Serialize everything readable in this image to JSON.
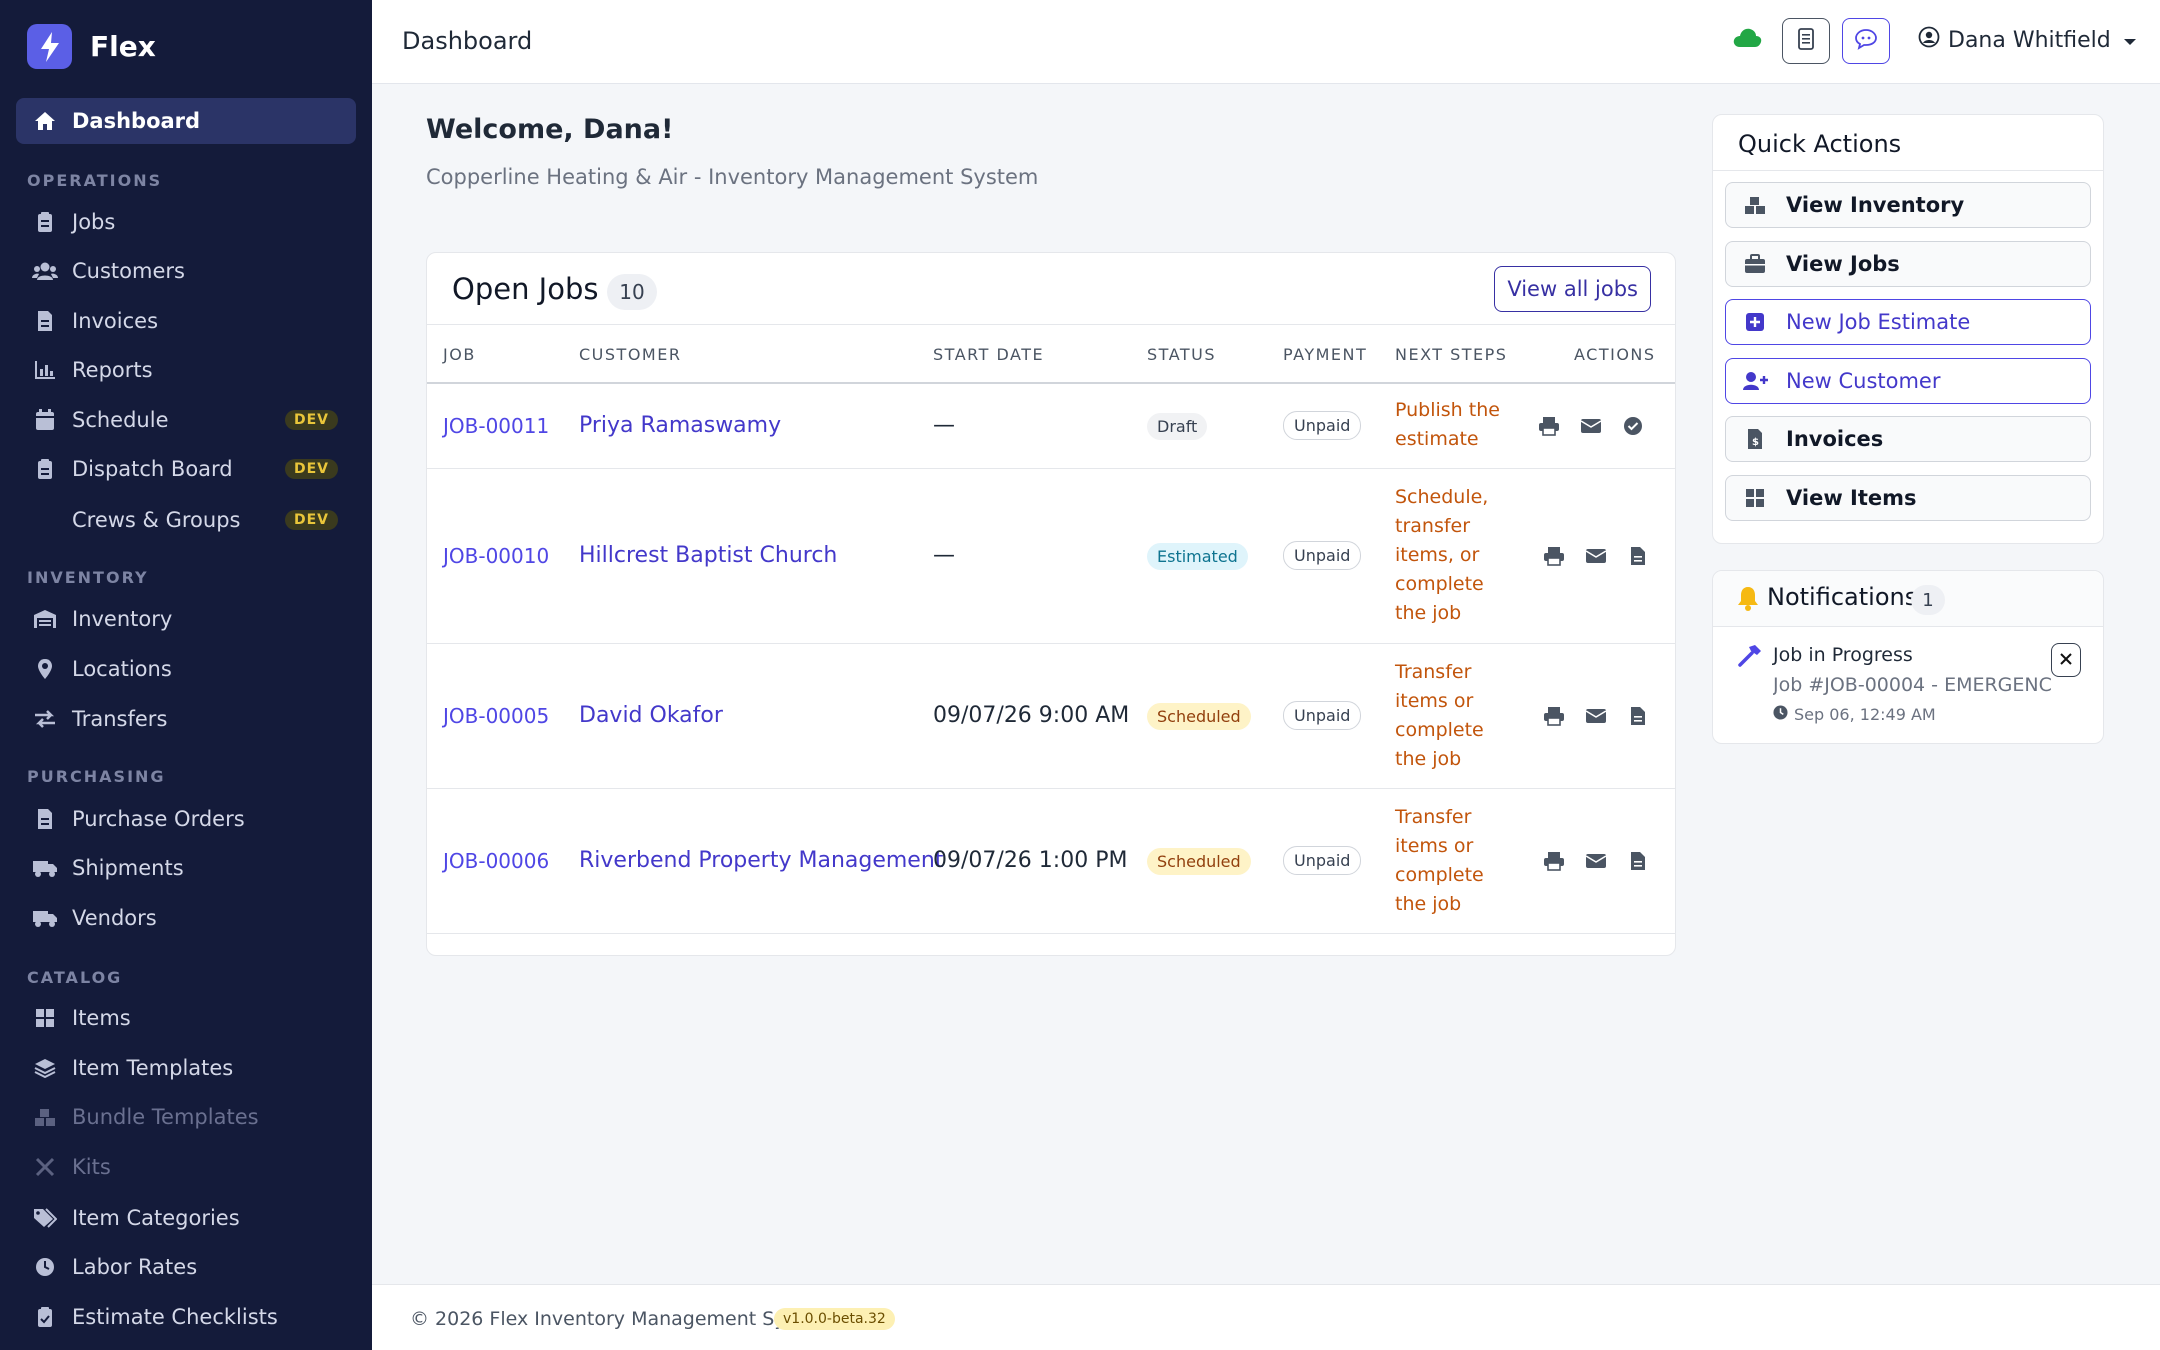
{
  "brand": {
    "name": "Flex"
  },
  "sidebar": {
    "dashboard": "Dashboard",
    "sections": {
      "operations": "OPERATIONS",
      "inventory": "INVENTORY",
      "purchasing": "PURCHASING",
      "catalog": "CATALOG"
    },
    "items": {
      "jobs": "Jobs",
      "customers": "Customers",
      "invoices": "Invoices",
      "reports": "Reports",
      "schedule": "Schedule",
      "dispatch": "Dispatch Board",
      "crews": "Crews & Groups",
      "inventory": "Inventory",
      "locations": "Locations",
      "transfers": "Transfers",
      "purchase_orders": "Purchase Orders",
      "shipments": "Shipments",
      "vendors": "Vendors",
      "items": "Items",
      "item_templates": "Item Templates",
      "bundle_templates": "Bundle Templates",
      "kits": "Kits",
      "item_categories": "Item Categories",
      "labor_rates": "Labor Rates",
      "estimate_checklists": "Estimate Checklists"
    },
    "dev_badge": "DEV"
  },
  "topbar": {
    "title": "Dashboard",
    "user": "Dana Whitfield"
  },
  "main": {
    "welcome": "Welcome, Dana!",
    "subtitle": "Copperline Heating & Air - Inventory Management System"
  },
  "open_jobs": {
    "title": "Open Jobs",
    "count": "10",
    "view_all": "View all jobs",
    "columns": {
      "job": "JOB",
      "customer": "CUSTOMER",
      "start_date": "START DATE",
      "status": "STATUS",
      "payment": "PAYMENT",
      "next_steps": "NEXT STEPS",
      "actions": "ACTIONS"
    },
    "rows": [
      {
        "job": "JOB-00011",
        "customer": "Priya Ramaswamy",
        "start": "—",
        "status": "Draft",
        "payment": "Unpaid",
        "next": "Publish the estimate"
      },
      {
        "job": "JOB-00010",
        "customer": "Hillcrest Baptist Church",
        "start": "—",
        "status": "Estimated",
        "payment": "Unpaid",
        "next": "Schedule, transfer items, or complete the job"
      },
      {
        "job": "JOB-00005",
        "customer": "David Okafor",
        "start": "09/07/26 9:00 AM",
        "status": "Scheduled",
        "payment": "Unpaid",
        "next": "Transfer items or complete the job"
      },
      {
        "job": "JOB-00006",
        "customer": "Riverbend Property Management",
        "start": "09/07/26 1:00 PM",
        "status": "Scheduled",
        "payment": "Unpaid",
        "next": "Transfer items or complete the job"
      }
    ]
  },
  "quick_actions": {
    "title": "Quick Actions",
    "view_inventory": "View Inventory",
    "view_jobs": "View Jobs",
    "new_job_estimate": "New Job Estimate",
    "new_customer": "New Customer",
    "invoices": "Invoices",
    "view_items": "View Items"
  },
  "notifications": {
    "title": "Notifications",
    "count": "1",
    "item_title": "Job in Progress",
    "item_body": "Job #JOB-00004 - EMERGENC...",
    "item_time": "Sep 06, 12:49 AM"
  },
  "footer": {
    "text": "© 2026 Flex Inventory Management System",
    "version": "v1.0.0-beta.32"
  },
  "colors": {
    "sidebar_bg": "#141b3a",
    "accent": "#4f46e5",
    "next_steps": "#c2550c",
    "cloud": "#22a745"
  }
}
